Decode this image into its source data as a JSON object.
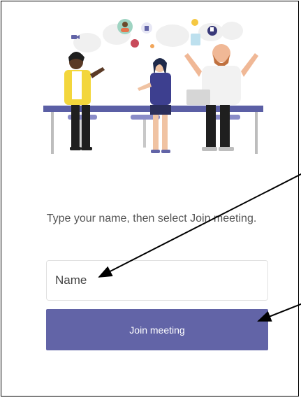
{
  "join": {
    "instruction": "Type your name, then select Join meeting.",
    "name_placeholder": "Name",
    "name_value": "",
    "button_label": "Join meeting"
  },
  "colors": {
    "accent": "#6264a7",
    "border": "#000000",
    "instruction_text": "#555555"
  },
  "icons": [
    "video-camera-icon",
    "thumbs-up-icon",
    "emoji-icon",
    "avatar-icon"
  ]
}
